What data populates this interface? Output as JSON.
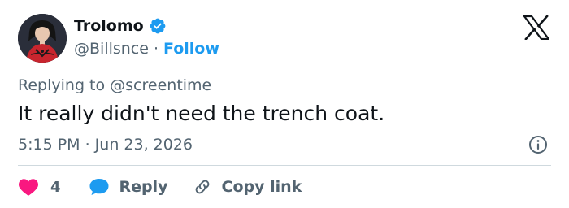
{
  "author": {
    "display_name": "Trolomo",
    "handle": "@Billsnce",
    "separator": "·",
    "follow_label": "Follow",
    "avatar_icon": "avatar-illustration",
    "verified_icon": "verified-badge-icon",
    "verified_color": "#1d9bf0"
  },
  "reply_context": "Replying to @screentime",
  "tweet": {
    "text": "It really didn't need the trench coat.",
    "timestamp": "5:15 PM · Jun 23, 2026"
  },
  "actions": {
    "like_count": "4",
    "reply_label": "Reply",
    "copy_link_label": "Copy link"
  },
  "icons": {
    "brand": "x-logo-icon",
    "info": "info-icon",
    "like": "heart-icon",
    "reply": "speech-bubble-icon",
    "copy": "link-icon"
  },
  "colors": {
    "accent": "#1d9bf0",
    "heart": "#f91880",
    "secondary_text": "#536471",
    "primary_text": "#0f1419",
    "divider": "#cfd9de"
  }
}
